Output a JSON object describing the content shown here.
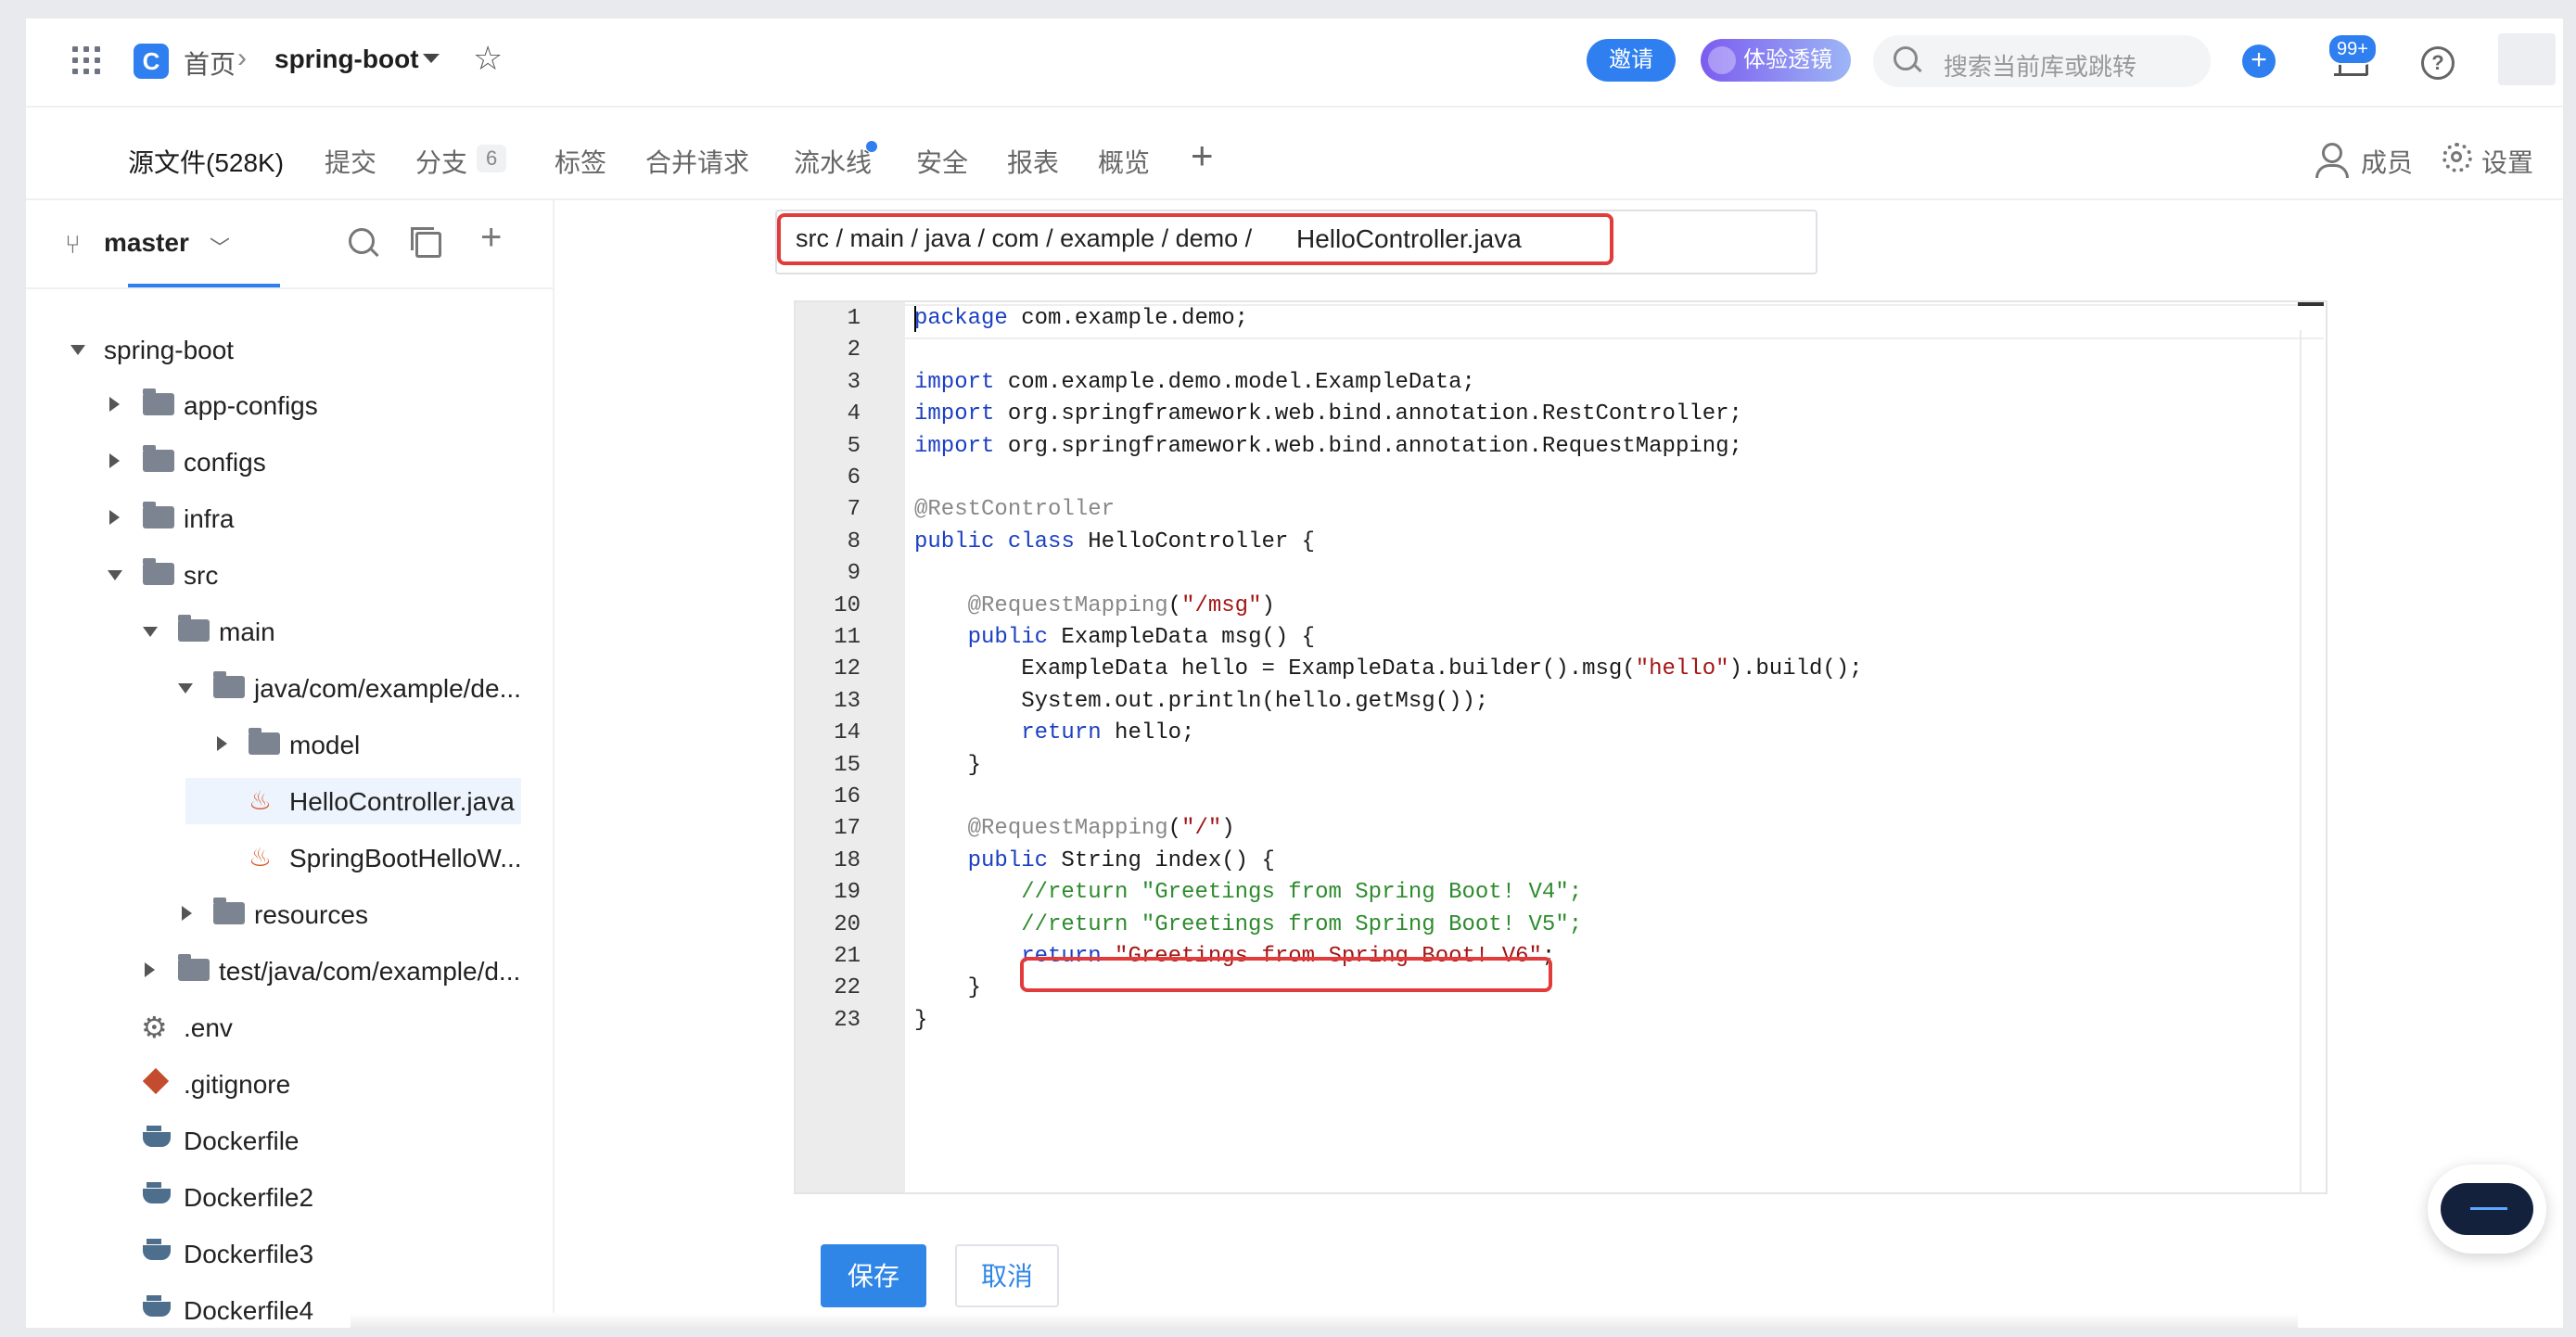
{
  "topbar": {
    "home": "首页",
    "repo": "spring-boot",
    "invite": "邀请",
    "lens": "体验透镜",
    "search_placeholder": "搜索当前库或跳转",
    "notifications": "99+"
  },
  "tabs": {
    "source": "源文件(528K)",
    "commits": "提交",
    "branches": "分支",
    "branches_count": "6",
    "tags": "标签",
    "merge_requests": "合并请求",
    "pipelines": "流水线",
    "security": "安全",
    "reports": "报表",
    "overview": "概览",
    "members": "成员",
    "settings": "设置"
  },
  "sidebar": {
    "branch": "master",
    "tree": [
      {
        "label": "spring-boot",
        "type": "root"
      },
      {
        "label": "app-configs",
        "type": "folder"
      },
      {
        "label": "configs",
        "type": "folder"
      },
      {
        "label": "infra",
        "type": "folder"
      },
      {
        "label": "src",
        "type": "folder"
      },
      {
        "label": "main",
        "type": "folder"
      },
      {
        "label": "java/com/example/de...",
        "type": "folder"
      },
      {
        "label": "model",
        "type": "folder"
      },
      {
        "label": "HelloController.java",
        "type": "java"
      },
      {
        "label": "SpringBootHelloW...",
        "type": "java"
      },
      {
        "label": "resources",
        "type": "folder"
      },
      {
        "label": "test/java/com/example/d...",
        "type": "folder"
      },
      {
        "label": ".env",
        "type": "config"
      },
      {
        "label": ".gitignore",
        "type": "git"
      },
      {
        "label": "Dockerfile",
        "type": "docker"
      },
      {
        "label": "Dockerfile2",
        "type": "docker"
      },
      {
        "label": "Dockerfile3",
        "type": "docker"
      },
      {
        "label": "Dockerfile4",
        "type": "docker"
      }
    ]
  },
  "editor": {
    "path": "src / main / java / com / example / demo /",
    "filename": "HelloController.java",
    "lines": [
      "package com.example.demo;",
      "",
      "import com.example.demo.model.ExampleData;",
      "import org.springframework.web.bind.annotation.RestController;",
      "import org.springframework.web.bind.annotation.RequestMapping;",
      "",
      "@RestController",
      "public class HelloController {",
      "",
      "    @RequestMapping(\"/msg\")",
      "    public ExampleData msg() {",
      "        ExampleData hello = ExampleData.builder().msg(\"hello\").build();",
      "        System.out.println(hello.getMsg());",
      "        return hello;",
      "    }",
      "",
      "    @RequestMapping(\"/\")",
      "    public String index() {",
      "        //return \"Greetings from Spring Boot! V4\";",
      "        //return \"Greetings from Spring Boot! V5\";",
      "        return \"Greetings from Spring Boot! V6\";",
      "    }",
      "}"
    ]
  },
  "actions": {
    "save": "保存",
    "cancel": "取消"
  }
}
